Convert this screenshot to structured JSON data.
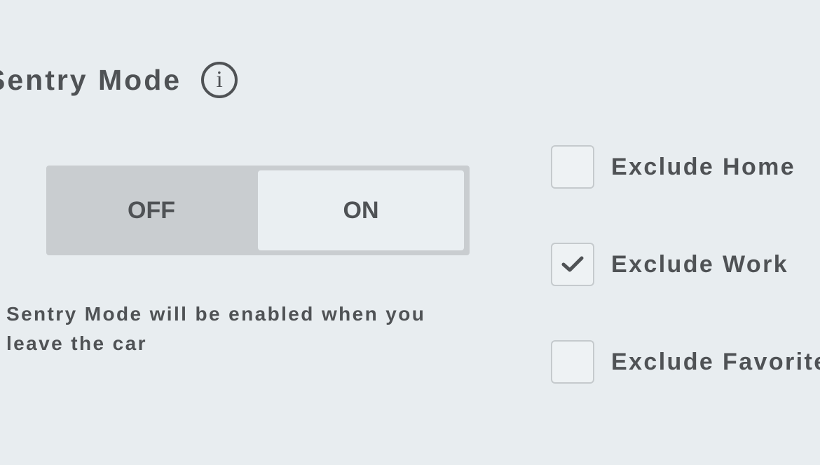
{
  "sentry": {
    "title": "Sentry Mode",
    "info_icon": "info-icon",
    "toggle": {
      "off_label": "OFF",
      "on_label": "ON",
      "selected": "ON"
    },
    "description": "Sentry Mode will be enabled when you leave the car"
  },
  "exclusions": [
    {
      "label": "Exclude Home",
      "checked": false
    },
    {
      "label": "Exclude Work",
      "checked": true
    },
    {
      "label": "Exclude Favorites",
      "checked": false
    }
  ],
  "colors": {
    "background": "#e8edf0",
    "text": "#4f5255",
    "toggle_track": "#c9cdd0",
    "toggle_selected": "#eaeff2",
    "checkbox_border": "#c5cacd"
  }
}
